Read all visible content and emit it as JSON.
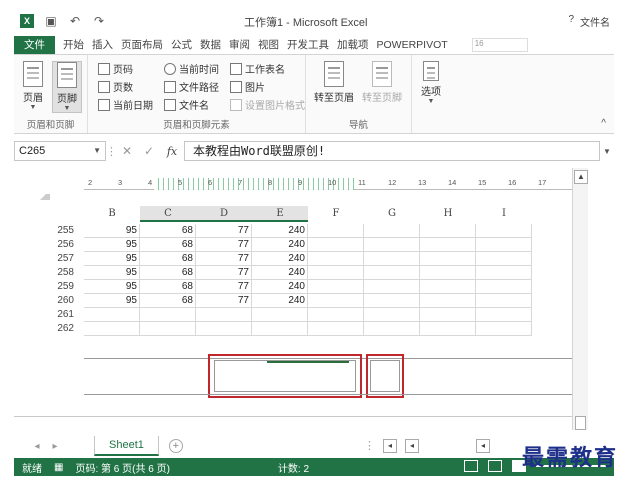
{
  "titlebar": {
    "logo": "X",
    "title": "工作簿1 - Microsoft Excel",
    "right_text": "文件名",
    "help": "?"
  },
  "tabs": [
    {
      "label": "文件"
    },
    {
      "label": "开始"
    },
    {
      "label": "插入"
    },
    {
      "label": "页面布局"
    },
    {
      "label": "公式"
    },
    {
      "label": "数据"
    },
    {
      "label": "审阅"
    },
    {
      "label": "视图"
    },
    {
      "label": "开发工具"
    },
    {
      "label": "加载项"
    },
    {
      "label": "POWERPIVOT"
    }
  ],
  "tab_input": "16",
  "ribbon": {
    "header_footer_group": {
      "label": "页眉和页脚",
      "header_btn": "页眉",
      "footer_btn": "页脚"
    },
    "elements_group": {
      "label": "页眉和页脚元素",
      "page_number": "页码",
      "page_count": "页数",
      "current_date": "当前日期",
      "current_time": "当前时间",
      "file_path": "文件路径",
      "file_name": "文件名",
      "sheet_name": "工作表名",
      "picture": "图片",
      "format_picture": "设置图片格式"
    },
    "navigation_group": {
      "label": "导航",
      "goto_header": "转至页眉",
      "goto_footer": "转至页脚"
    },
    "options": "选项"
  },
  "formula_bar": {
    "cell_ref": "C265",
    "fx": "fx",
    "content": "本教程由Word联盟原创!"
  },
  "ruler": [
    "2",
    "3",
    "4",
    "5",
    "6",
    "7",
    "8",
    "9",
    "10",
    "11",
    "12",
    "13",
    "14",
    "15",
    "16",
    "17"
  ],
  "columns": [
    "B",
    "C",
    "D",
    "E",
    "F",
    "G",
    "H",
    "I"
  ],
  "rows": [
    {
      "num": "255",
      "values": [
        "95",
        "68",
        "77",
        "240"
      ]
    },
    {
      "num": "256",
      "values": [
        "95",
        "68",
        "77",
        "240"
      ]
    },
    {
      "num": "257",
      "values": [
        "95",
        "68",
        "77",
        "240"
      ]
    },
    {
      "num": "258",
      "values": [
        "95",
        "68",
        "77",
        "240"
      ]
    },
    {
      "num": "259",
      "values": [
        "95",
        "68",
        "77",
        "240"
      ]
    },
    {
      "num": "260",
      "values": [
        "95",
        "68",
        "77",
        "240"
      ]
    },
    {
      "num": "261",
      "values": [
        "",
        "",
        "",
        ""
      ]
    },
    {
      "num": "262",
      "values": [
        "",
        "",
        "",
        ""
      ]
    }
  ],
  "sheet_tab": "Sheet1",
  "statusbar": {
    "ready": "就绪",
    "page_info": "页码: 第 6 页(共 6 页)",
    "count": "计数: 2"
  },
  "watermark": "最需教育",
  "colors": {
    "excel_green": "#217346",
    "highlight_red": "#c0272d"
  }
}
